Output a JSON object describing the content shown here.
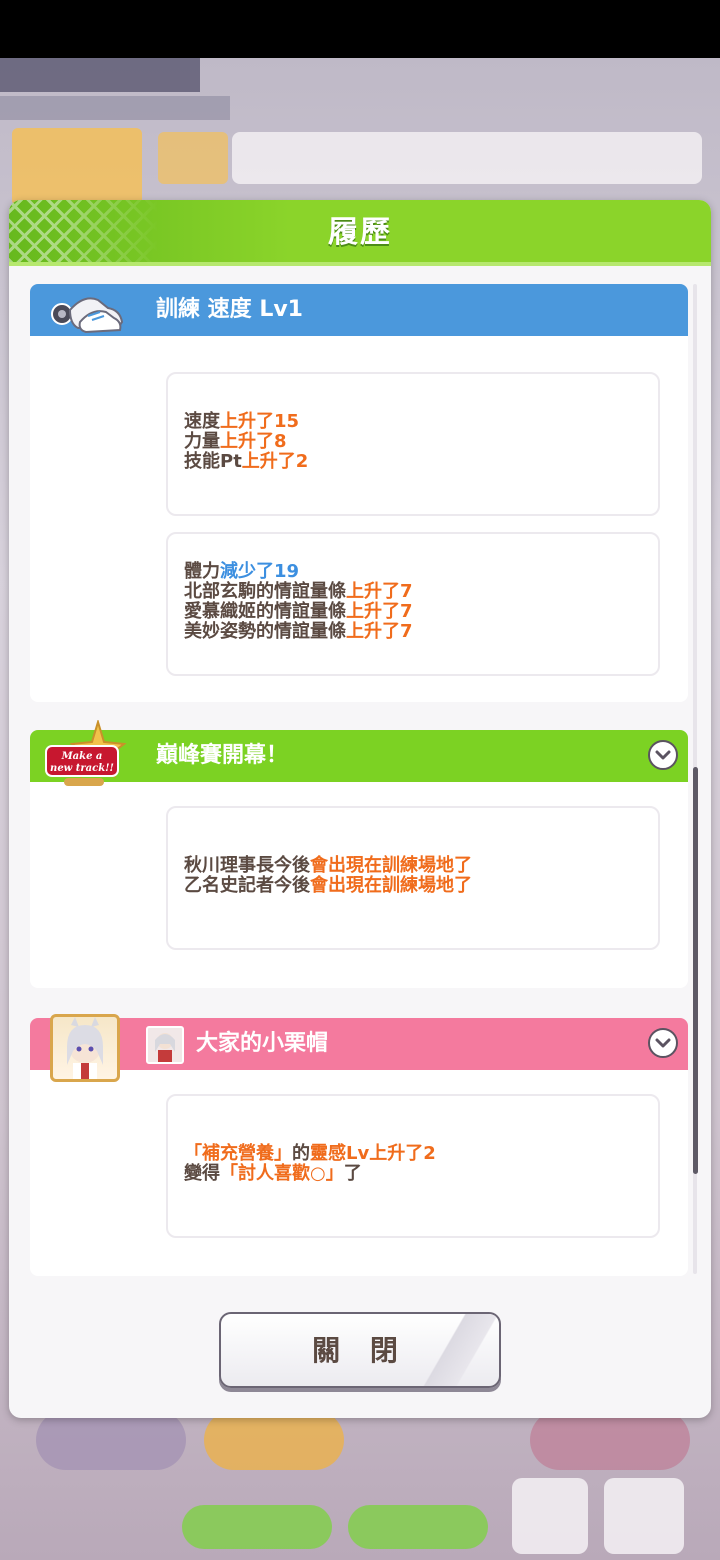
{
  "dialog": {
    "title": "履歷",
    "close_label": "關 閉"
  },
  "entries": [
    {
      "title": "訓練 速度 Lv1",
      "color": "#4b98dc",
      "icon": "shoe-icon",
      "boxes": [
        [
          [
            {
              "t": "速度"
            },
            {
              "t": "上升了15",
              "c": "o"
            }
          ],
          [
            {
              "t": "力量"
            },
            {
              "t": "上升了8",
              "c": "o"
            }
          ],
          [
            {
              "t": "技能Pt"
            },
            {
              "t": "上升了2",
              "c": "o"
            }
          ]
        ],
        [
          [
            {
              "t": "體力"
            },
            {
              "t": "減少了19",
              "c": "b"
            }
          ],
          [
            {
              "t": "北部玄駒的情誼量條"
            },
            {
              "t": "上升了7",
              "c": "o"
            }
          ],
          [
            {
              "t": "愛慕織姬的情誼量條"
            },
            {
              "t": "上升了7",
              "c": "o"
            }
          ],
          [
            {
              "t": "美妙姿勢的情誼量條"
            },
            {
              "t": "上升了7",
              "c": "o"
            }
          ]
        ]
      ]
    },
    {
      "title": "巔峰賽開幕！",
      "color": "#7cd223",
      "icon": "make-a-new-track-badge-icon",
      "badge_text": [
        "Make a",
        "new track!!"
      ],
      "boxes": [
        [
          [
            {
              "t": "秋川理事長今後"
            },
            {
              "t": "會出現在訓練場地了",
              "c": "o"
            }
          ],
          [
            {
              "t": "乙名史記者今後"
            },
            {
              "t": "會出現在訓練場地了",
              "c": "o"
            }
          ]
        ]
      ]
    },
    {
      "title": "大家的小栗帽",
      "color": "#f47a9e",
      "icon": "character-portrait-icon",
      "boxes": [
        [
          [
            {
              "t": "「補充營養」",
              "c": "o"
            },
            {
              "t": "的"
            },
            {
              "t": "靈感",
              "c": "o"
            },
            {
              "t": "Lv上升了2",
              "c": "o"
            }
          ],
          [
            {
              "t": "變得"
            },
            {
              "t": "「討人喜歡○」",
              "c": "o"
            },
            {
              "t": "了"
            }
          ]
        ]
      ]
    }
  ]
}
